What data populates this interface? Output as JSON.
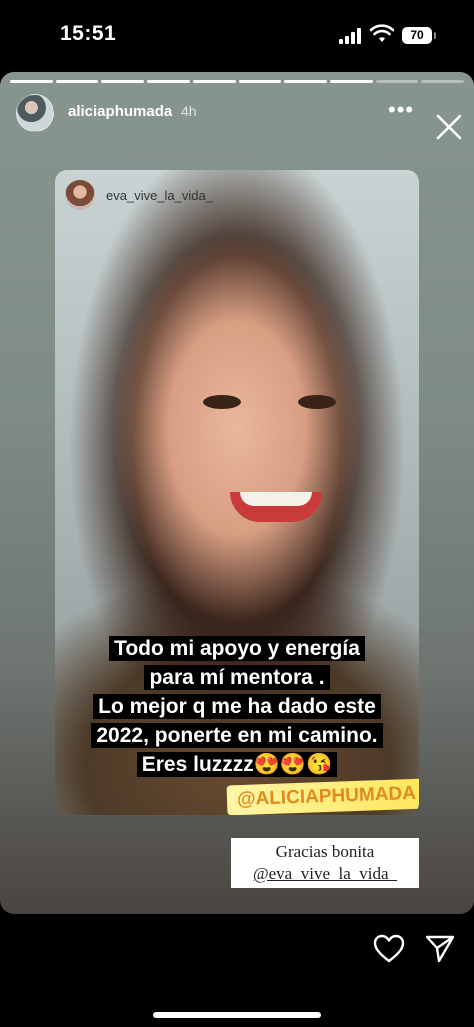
{
  "status_bar": {
    "time": "15:51",
    "battery": "70"
  },
  "story": {
    "progress": {
      "total_segments": 10,
      "completed_segments": 8
    },
    "header": {
      "username": "aliciaphumada",
      "time_ago": "4h"
    },
    "shared_post": {
      "username": "eva_vive_la_vida_",
      "caption_lines": [
        "Todo mi apoyo y energía",
        "para mí mentora .",
        "Lo mejor q me ha dado este",
        "2022, ponerte en mi camino.",
        "Eres luzzzz😍😍😘"
      ],
      "mention": "@ALICIAPHUMADA"
    },
    "reply_sticker": {
      "line1": "Gracias bonita",
      "line2": "@eva_vive_la_vida_"
    }
  },
  "icons": {
    "more": "more-icon",
    "close": "close-icon",
    "like": "heart-icon",
    "share": "send-icon"
  }
}
